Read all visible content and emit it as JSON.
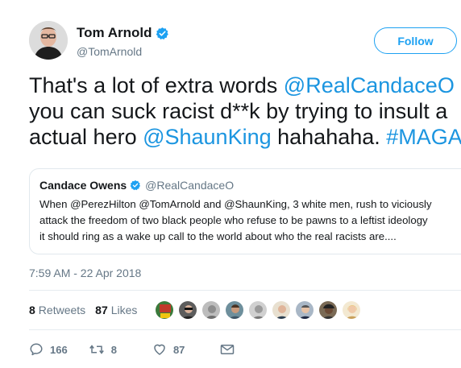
{
  "author": {
    "name": "Tom Arnold",
    "handle": "@TomArnold"
  },
  "follow_label": "Follow",
  "tweet": {
    "line1_text": "That's a lot of extra words ",
    "line1_mention": "@RealCandaceO",
    "line2_text": "you can suck racist d**k by trying to insult a",
    "line3_text": "actual hero ",
    "line3_mention": "@ShaunKing",
    "line3_middle": " hahahaha. ",
    "line3_hashtag": "#MAGA"
  },
  "quoted": {
    "name": "Candace Owens",
    "handle": "@RealCandaceO",
    "line1": "When @PerezHilton @TomArnold and @ShaunKing, 3 white men, rush to viciously",
    "line2": "attack the freedom of two black people who refuse to be pawns to a leftist ideology",
    "line3": "it should ring as a wake up call to the world about who the real racists are...."
  },
  "timestamp": "7:59 AM - 22 Apr 2018",
  "stats": {
    "retweets_count": "8",
    "retweets_label": "Retweets",
    "likes_count": "87",
    "likes_label": "Likes"
  },
  "actions": {
    "replies": "166",
    "retweets": "8",
    "likes": "87"
  },
  "colors": {
    "link": "#1b95e0",
    "accent": "#1da1f2",
    "muted": "#657786"
  }
}
